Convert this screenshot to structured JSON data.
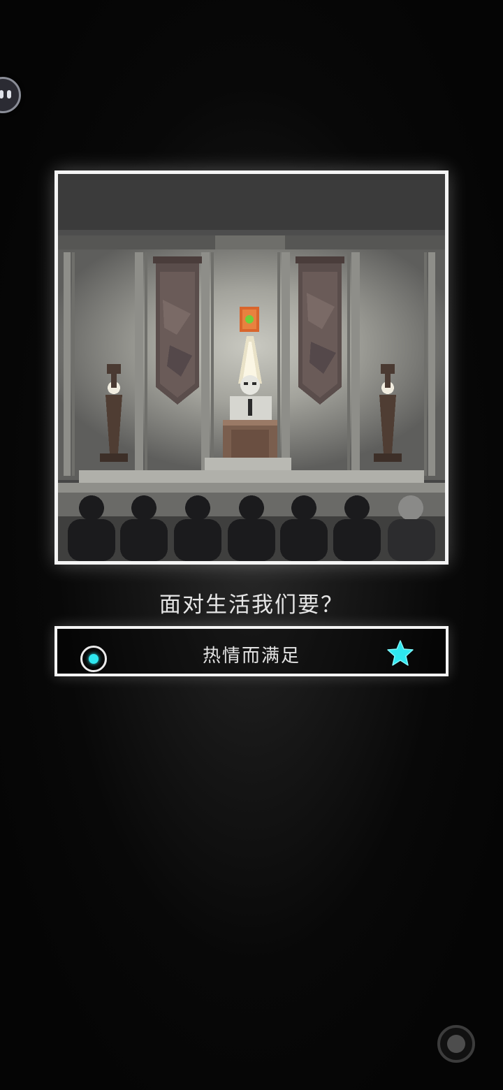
{
  "scene": {
    "question": "面对生活我们要？",
    "choice": {
      "label": "热情而满足",
      "selected": true,
      "starred": true
    }
  },
  "colors": {
    "accent": "#2ee8f0",
    "frame": "#f4f4f4",
    "text": "#e6e6e6",
    "background": "#050505"
  },
  "icons": {
    "floating_assistant": "assistant-face-icon",
    "selection": "radio-selected-icon",
    "favorite": "star-icon",
    "record": "record-icon"
  }
}
